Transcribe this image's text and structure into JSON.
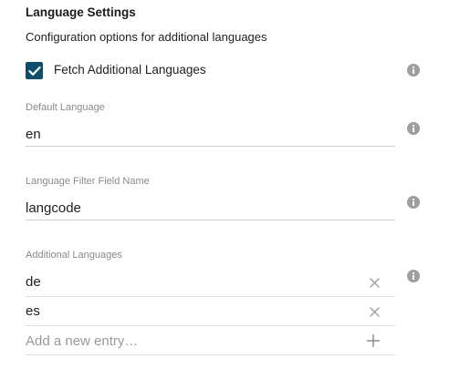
{
  "section": {
    "title": "Language Settings",
    "description": "Configuration options for additional languages"
  },
  "fetch_additional": {
    "label": "Fetch Additional Languages",
    "checked": true
  },
  "default_language": {
    "label": "Default Language",
    "value": "en"
  },
  "filter_field": {
    "label": "Language Filter Field Name",
    "value": "langcode"
  },
  "additional_languages": {
    "label": "Additional Languages",
    "entries": [
      "de",
      "es"
    ],
    "placeholder": "Add a new entry…"
  },
  "colors": {
    "accent": "#0d4f6b",
    "info_icon": "#9e9e9e",
    "label_gray": "#8a8a8a"
  },
  "icons": {
    "checkbox": "check-icon",
    "info": "info-icon",
    "remove": "close-icon",
    "add": "plus-icon"
  }
}
